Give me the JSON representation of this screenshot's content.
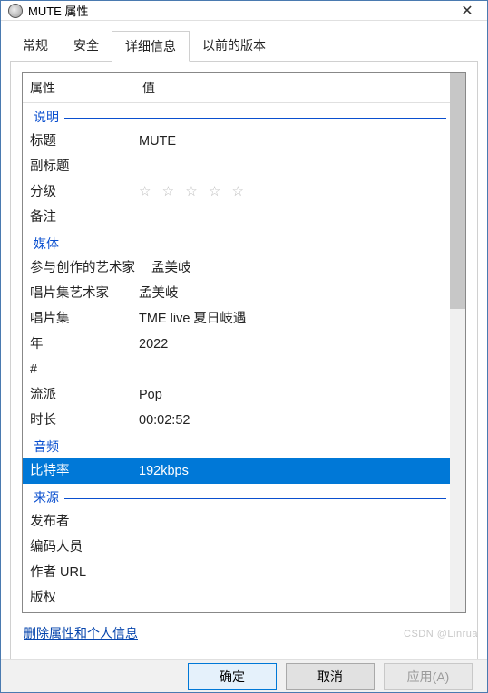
{
  "window": {
    "title": "MUTE 属性"
  },
  "tabs": {
    "general": "常规",
    "security": "安全",
    "details": "详细信息",
    "previous": "以前的版本"
  },
  "header": {
    "property": "属性",
    "value": "值"
  },
  "groups": {
    "description": "说明",
    "media": "媒体",
    "audio": "音频",
    "source": "来源"
  },
  "rows": {
    "title_k": "标题",
    "title_v": "MUTE",
    "subtitle_k": "副标题",
    "subtitle_v": "",
    "rating_k": "分级",
    "remark_k": "备注",
    "remark_v": "",
    "artist_k": "参与创作的艺术家",
    "artist_v": "孟美岐",
    "albumartist_k": "唱片集艺术家",
    "albumartist_v": "孟美岐",
    "album_k": "唱片集",
    "album_v": "TME live 夏日岐遇",
    "year_k": "年",
    "year_v": "2022",
    "track_k": "#",
    "track_v": "",
    "genre_k": "流派",
    "genre_v": "Pop",
    "length_k": "时长",
    "length_v": "00:02:52",
    "bitrate_k": "比特率",
    "bitrate_v": "192kbps",
    "publisher_k": "发布者",
    "publisher_v": "",
    "encoder_k": "编码人员",
    "encoder_v": "",
    "authorurl_k": "作者 URL",
    "authorurl_v": "",
    "copyright_k": "版权",
    "copyright_v": ""
  },
  "link": "删除属性和个人信息",
  "buttons": {
    "ok": "确定",
    "cancel": "取消",
    "apply": "应用(A)"
  },
  "watermark": "CSDN @Linrua"
}
